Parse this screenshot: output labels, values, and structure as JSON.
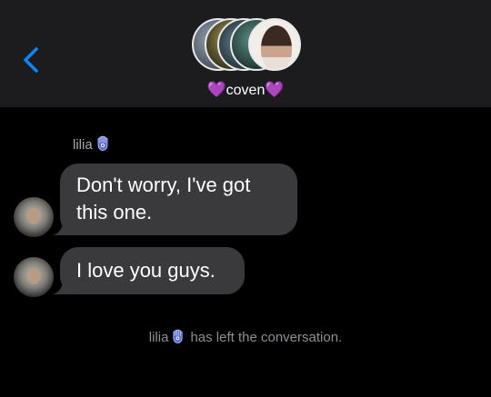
{
  "header": {
    "group_name": "coven",
    "heart_left": "💜",
    "heart_right": "💜",
    "back_icon": "chevron-left-icon"
  },
  "messages": {
    "sender_name": "lilia",
    "sender_emoji": "hamsa-icon",
    "items": [
      {
        "text_line1": "Don't worry, I've got",
        "text_line2": "this one."
      },
      {
        "text": "I love you guys."
      }
    ]
  },
  "system_message": {
    "name": "lilia",
    "text": "has left the conversation."
  },
  "colors": {
    "header_bg": "#1c1c1e",
    "bubble_bg": "#3a3a3c",
    "accent": "#0a84ff",
    "secondary_text": "#8e8e93"
  }
}
